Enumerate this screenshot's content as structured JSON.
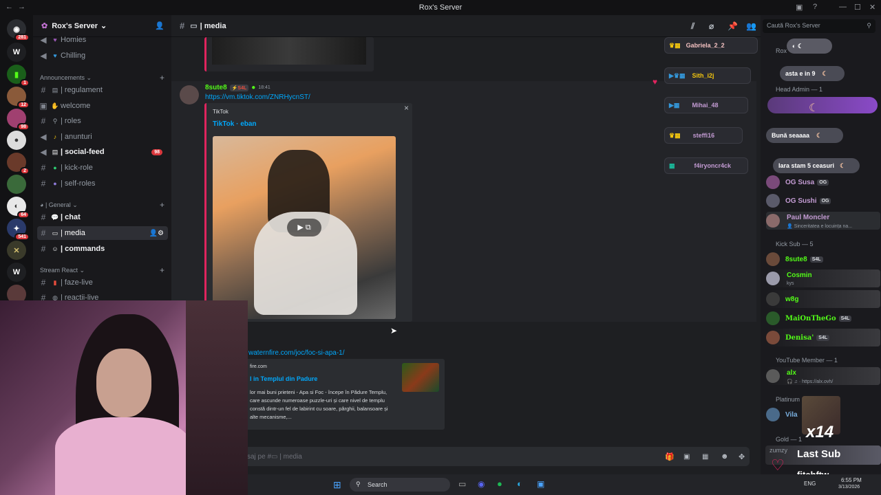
{
  "window": {
    "title": "Rox's Server"
  },
  "guild_badges": [
    "281",
    "1",
    "12",
    "98",
    "2",
    "64",
    "541"
  ],
  "server": {
    "name": "Rox's Server"
  },
  "channels": {
    "top": [
      {
        "label": "Homies"
      },
      {
        "label": "Chilling"
      }
    ],
    "announcements_label": "Announcements",
    "announcements": [
      {
        "label": "| regulament"
      },
      {
        "label": "welcome"
      },
      {
        "label": "| roles"
      },
      {
        "label": "| anunturi"
      },
      {
        "label": "| social-feed",
        "badge": "98"
      },
      {
        "label": "| kick-role"
      },
      {
        "label": "| self-roles"
      }
    ],
    "general_label": "| General",
    "general": [
      {
        "label": "| chat"
      },
      {
        "label": "| media"
      },
      {
        "label": "| commands"
      }
    ],
    "stream_label": "Stream React",
    "stream": [
      {
        "label": "| faze-live"
      },
      {
        "label": "| reactii-live"
      }
    ]
  },
  "channel_header": {
    "name": "| media"
  },
  "search": {
    "placeholder": "Caută Rox's Server"
  },
  "message": {
    "author": "8sute8",
    "tag": "S4L",
    "time": "18:41",
    "link": "https://vm.tiktok.com/ZNRHycnST/",
    "embed_provider": "TikTok",
    "embed_title": "TikTok · eban",
    "close": "×"
  },
  "second_message": {
    "link": "waternfire.com/joc/foc-si-apa-1/",
    "provider": "fire.com",
    "title": "l in Templul din Padure",
    "desc": "lor mai buni prieteni - Apa si Foc - începe în Pădure Templu, care ascunde numeroase puzzle-uri și care nivel de templu constă dintr-un fel de labirint cu soare, pârghii, balansoare și alte mecanisme,..."
  },
  "input": {
    "placeholder": "saj pe #▭ | media"
  },
  "voice_users": [
    {
      "name": "Gabriela_2_2"
    },
    {
      "name": "Sith_i2j"
    },
    {
      "name": "Mihai_48"
    },
    {
      "name": "steffi16"
    },
    {
      "name": "f4iryoncr4ck"
    }
  ],
  "bubbles": [
    {
      "text": "asta e in 9"
    },
    {
      "text": "Bună seaaaa"
    },
    {
      "text": "Iara stam 5 ceasuri"
    }
  ],
  "members": {
    "roles_label": "Rox",
    "head_admin": "Head Admin — 1",
    "list_a": [
      {
        "name": "OG Susa",
        "tag": "OG",
        "color": "#c39bd3"
      },
      {
        "name": "OG Sushi",
        "tag": "OG",
        "color": "#c39bd3"
      },
      {
        "name": "Paul Moncler",
        "sub": "👤 Sinceritatea e locuința na...",
        "color": "#c39bd3"
      }
    ],
    "kick_sub": "Kick Sub — 5",
    "kick_list": [
      {
        "name": "8sute8",
        "tag": "S4L",
        "color": "#53fc18"
      },
      {
        "name": "Cosmin",
        "sub": "kys",
        "color": "#53fc18"
      },
      {
        "name": "w8g",
        "color": "#53fc18"
      },
      {
        "name": "MaiOnTheGo",
        "tag": "S4L",
        "color": "#53fc18"
      },
      {
        "name": "Denisa'",
        "tag": "S4L",
        "color": "#53fc18"
      }
    ],
    "yt_member": "YouTube Member — 1",
    "yt_list": [
      {
        "name": "alx",
        "sub": "🎧 ♫ · https://alx.ovh/",
        "color": "#53fc18"
      }
    ],
    "platinum": "Platinum",
    "platinum_name": "Vila",
    "gold": "Gold — 1",
    "gold_name": "zumzy"
  },
  "overlay": {
    "multiplier": "x14",
    "last_sub": "Last Sub",
    "sub_name": "fitchftw"
  },
  "taskbar": {
    "search": "Search",
    "lang": "ENG",
    "time": "6:55 PM",
    "date": "3/13/2026"
  }
}
